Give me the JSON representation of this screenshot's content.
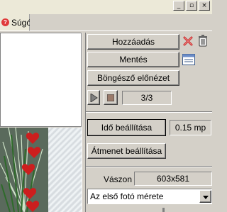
{
  "titlebar": {
    "minimize_icon": "minimize-icon",
    "restore_icon": "restore-icon",
    "close_icon": "close-icon",
    "minimize_glyph": "_",
    "restore_glyph": "▫",
    "close_glyph": "×"
  },
  "tab": {
    "label": "Súgó",
    "icon": "help-icon",
    "icon_glyph": "?"
  },
  "actions": {
    "add_label": "Hozzáadás",
    "save_label": "Mentés",
    "preview_label": "Böngésző előnézet"
  },
  "playback": {
    "counter": "3/3"
  },
  "timing": {
    "time_button": "Idő beállítása",
    "time_value": "0.15 mp",
    "transition_button": "Átmenet beállítása"
  },
  "canvas": {
    "label": "Vászon",
    "size_value": "603x581",
    "size_select_value": "Az első fotó mérete"
  },
  "colors": {
    "accent_red": "#cc1e1e",
    "delete_x": "#c83232",
    "panel_bg": "#d4d0c8"
  }
}
